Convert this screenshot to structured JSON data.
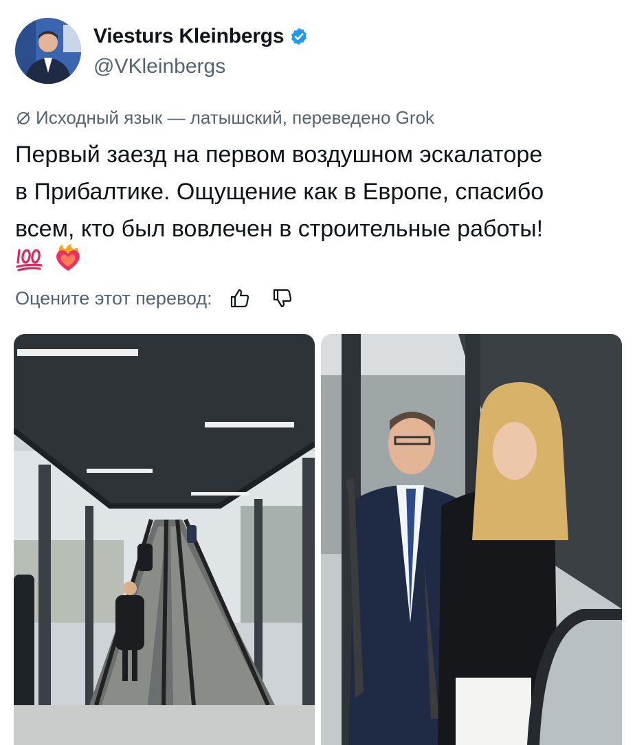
{
  "author": {
    "name": "Viesturs Kleinbergs",
    "handle": "@VKleinbergs",
    "verified": true,
    "avatar_icon": "profile-photo"
  },
  "translation_note": "Исходный язык — латышский, переведено Grok",
  "post": {
    "lines": [
      "Первый заезд на первом воздушном эскалаторе",
      "в Прибалтике. Ощущение как в Европе, спасибо",
      "всем, кто был вовлечен в строительные работы!"
    ],
    "emojis": [
      "hundred-points-emoji",
      "heart-on-fire-emoji"
    ]
  },
  "rate": {
    "label": "Оцените этот перевод:",
    "icons": [
      "thumbs-up-icon",
      "thumbs-down-icon"
    ]
  },
  "media": [
    {
      "kind": "photo",
      "subject": "escalator-covered-walkway"
    },
    {
      "kind": "photo",
      "subject": "two-people-on-escalator"
    }
  ],
  "colors": {
    "text": "#0f1419",
    "secondary": "#536471",
    "verified": "#1d9bf0"
  }
}
